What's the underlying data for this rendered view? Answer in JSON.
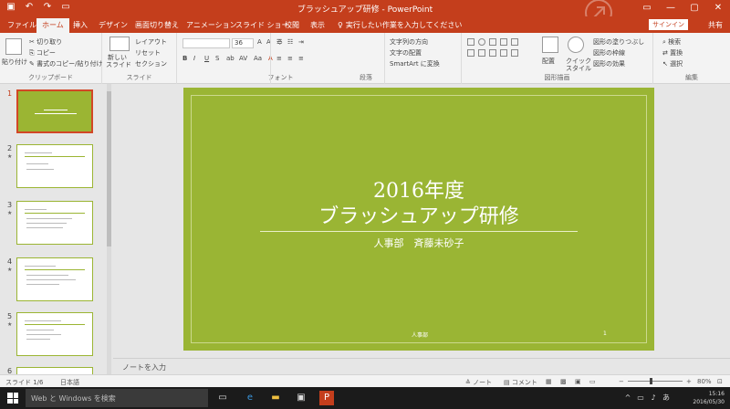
{
  "app": {
    "doc_title": "ブラッシュアップ研修 - PowerPoint",
    "accent": "#c43e1c",
    "slide_green": "#9ab534"
  },
  "qat": {
    "save_icon": "save-icon",
    "undo_icon": "undo-icon",
    "redo_icon": "redo-icon",
    "start_icon": "slideshow-start-icon"
  },
  "tabs": [
    "ファイル",
    "ホーム",
    "挿入",
    "デザイン",
    "画面切り替え",
    "アニメーション",
    "スライド ショー",
    "校閲",
    "表示"
  ],
  "tellme": "実行したい作業を入力してください",
  "signin": "サインイン",
  "share": "共有",
  "ribbon": {
    "clipboard": {
      "label": "クリップボード",
      "paste": "貼り付け",
      "cut": "切り取り",
      "copy": "コピー",
      "format_painter": "書式のコピー/貼り付け"
    },
    "slides": {
      "label": "スライド",
      "new_slide": "新しい",
      "new_slide2": "スライド",
      "layout": "レイアウト",
      "reset": "リセット",
      "section": "セクション"
    },
    "font": {
      "label": "フォント",
      "size": "36"
    },
    "paragraph": {
      "label": "段落",
      "text_direction": "文字列の方向",
      "align_text": "文字の配置",
      "smartart": "SmartArt に変換"
    },
    "drawing": {
      "label": "図形描画",
      "arrange": "配置",
      "quick_styles": "クイック",
      "quick_styles2": "スタイル",
      "fill": "図形の塗りつぶし",
      "outline": "図形の枠線",
      "effects": "図形の効果"
    },
    "editing": {
      "label": "編集",
      "find": "検索",
      "replace": "置換",
      "select": "選択"
    }
  },
  "thumbnails": [
    {
      "num": "1",
      "active": true
    },
    {
      "num": "2",
      "active": false
    },
    {
      "num": "3",
      "active": false
    },
    {
      "num": "4",
      "active": false
    },
    {
      "num": "5",
      "active": false
    },
    {
      "num": "6",
      "active": false
    }
  ],
  "slide": {
    "title_line1": "2016年度",
    "title_line2": "ブラッシュアップ研修",
    "subtitle": "人事部　斉藤未砂子",
    "footer": "人事部",
    "page": "1"
  },
  "notes_placeholder": "ノートを入力",
  "status": {
    "slide_info": "スライド 1/6",
    "language": "日本語",
    "notes": "ノート",
    "comments": "コメント",
    "zoom": "80%"
  },
  "taskbar": {
    "search_placeholder": "Web と Windows を検索",
    "time": "15:16",
    "date": "2016/05/30"
  }
}
